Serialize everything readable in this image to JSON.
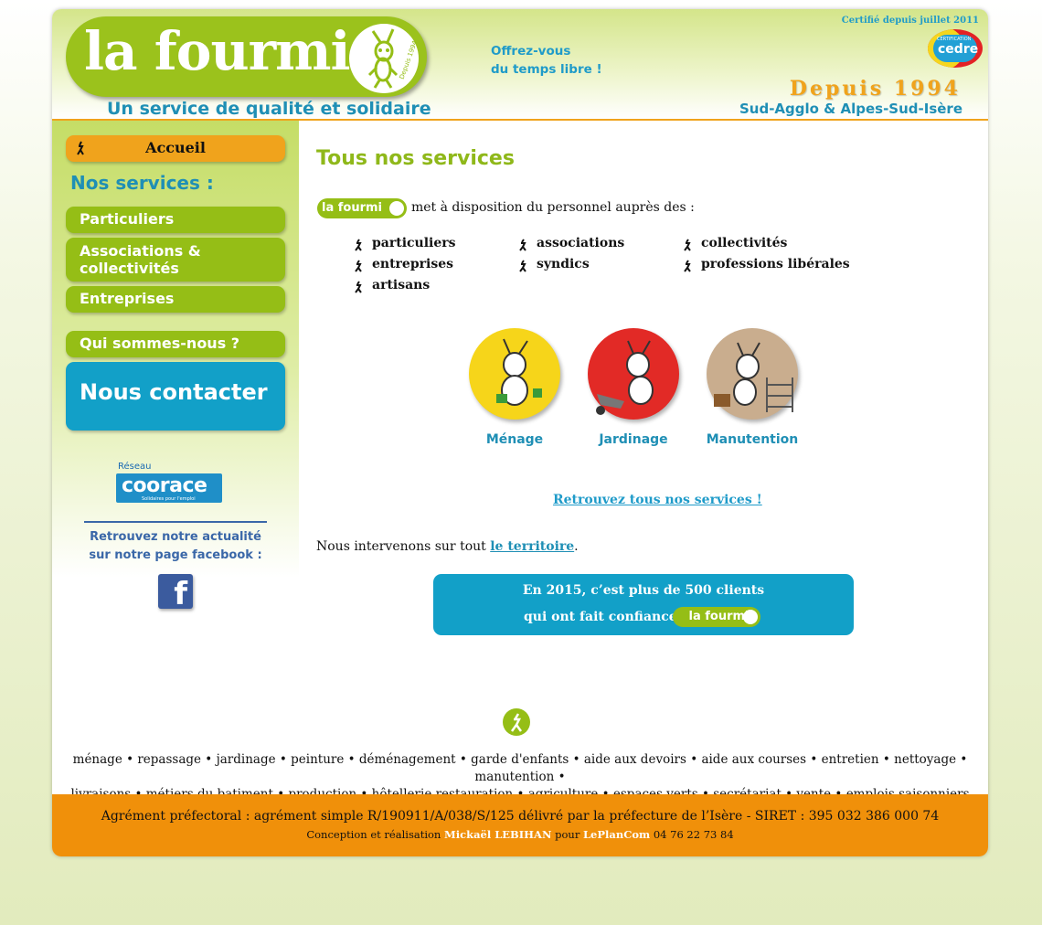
{
  "header": {
    "logo_text": "la fourmi",
    "logo_badge": "Depuis 1994",
    "tagline": "Un service de qualité et solidaire",
    "offrez_line1": "Offrez-vous",
    "offrez_line2": "du temps libre !",
    "certified": "Certifié depuis juillet 2011",
    "cedre_small": "CERTIFICATION",
    "cedre_word": "cedre",
    "since": "Depuis 1994",
    "region": "Sud-Agglo & Alpes-Sud-Isère"
  },
  "sidebar": {
    "accueil": "Accueil",
    "nos_services": "Nos services :",
    "particuliers": "Particuliers",
    "associations_l1": "Associations &",
    "associations_l2": "collectivités",
    "entreprises": "Entreprises",
    "qui": "Qui sommes-nous ?",
    "contact": "Nous contacter",
    "corace_reseau": "Réseau",
    "corace_word": "coorace",
    "corace_sub": "Solidaires pour l'emploi",
    "fb_line1": "Retrouvez notre actualité",
    "fb_line2": "sur notre page facebook :",
    "fb_letter": "f"
  },
  "main": {
    "title": "Tous nos services",
    "intro_logo": "la fourmi",
    "intro_text": "met à disposition du personnel auprès des :",
    "services": {
      "particuliers": "particuliers",
      "associations": "associations",
      "collectivites": "collectivités",
      "entreprises": "entreprises",
      "syndics": "syndics",
      "professions": "professions libérales",
      "artisans": "artisans"
    },
    "categories": {
      "menage": "Ménage",
      "jardinage": "Jardinage",
      "manutention": "Manutention"
    },
    "all_services_link": "Retrouvez tous nos services !",
    "territory_text": "Nous intervenons sur tout ",
    "territory_link": "le territoire",
    "territory_dot": ".",
    "banner_line1": "En 2015, c’est plus de 500 clients",
    "banner_line2": "qui ont fait confiance à",
    "banner_logo": "la fourmi"
  },
  "keywords_line1": "ménage • repassage • jardinage • peinture • déménagement • garde d'enfants • aide aux devoirs • aide aux courses • entretien • nettoyage • manutention •",
  "keywords_line2": "livraisons • métiers du batiment • production • hôtellerie restauration • agriculture • espaces verts • secrétariat • vente • emplois saisonniers",
  "footer": {
    "agrement": "Agrément préfectoral : agrément simple R/190911/A/038/S/125 délivré par la préfecture de l’Isère - SIRET : 395 032 386 000 74",
    "credit_prefix": "Conception et réalisation ",
    "credit_author": "Mickaël LEBIHAN",
    "credit_mid": " pour ",
    "credit_company": "LePlanCom",
    "credit_phone": " 04 76 22 73 84"
  },
  "colors": {
    "green": "#95be16",
    "blue": "#12a0c8",
    "orange": "#f0a31c",
    "menage_circle": "#f6d51a",
    "jardinage_circle": "#e22a26",
    "manutention_circle": "#c9ad8e"
  }
}
